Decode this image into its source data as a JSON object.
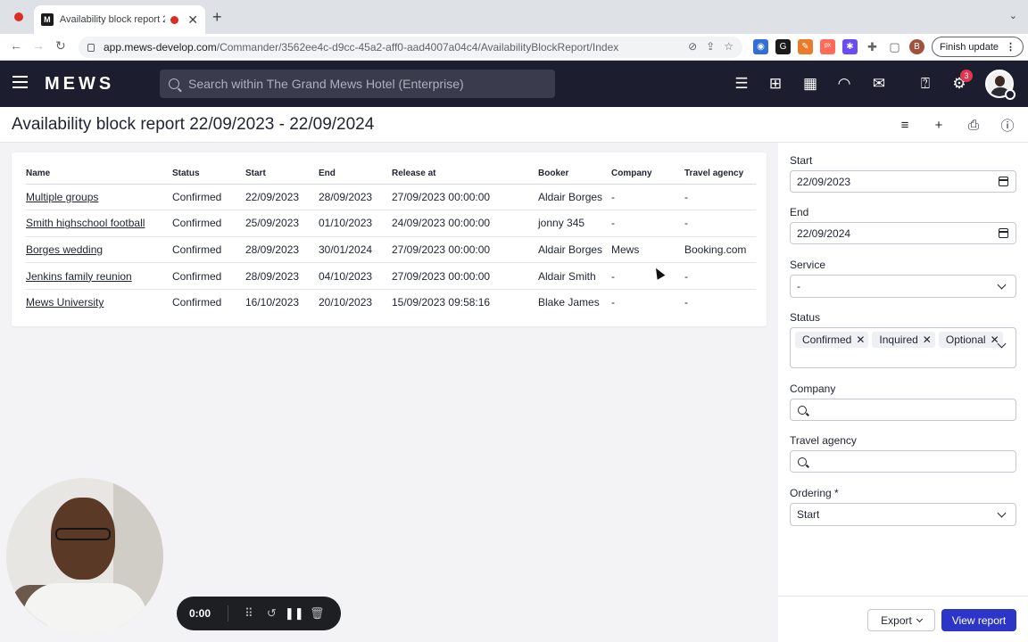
{
  "browser": {
    "tab_title": "Availability block report 2",
    "tab_close": "✕",
    "new_tab": "+",
    "url_main": "app.mews-develop.com",
    "url_path": "/Commander/3562ee4c-d9cc-45a2-aff0-aad4007a04c4/AvailabilityBlockReport/Index",
    "profile_initial": "B",
    "finish_update": "Finish update"
  },
  "header": {
    "logo": "MEWS",
    "search_placeholder": "Search within The Grand Mews Hotel (Enterprise)",
    "notification_count": "3"
  },
  "page": {
    "title": "Availability block report 22/09/2023 - 22/09/2024"
  },
  "table": {
    "columns": [
      "Name",
      "Status",
      "Start",
      "End",
      "Release at",
      "Booker",
      "Company",
      "Travel agency"
    ],
    "rows": [
      {
        "name": "Multiple groups",
        "status": "Confirmed",
        "start": "22/09/2023",
        "end": "28/09/2023",
        "release": "27/09/2023 00:00:00",
        "booker": "Aldair Borges",
        "company": "-",
        "agency": "-"
      },
      {
        "name": "Smith highschool football",
        "status": "Confirmed",
        "start": "25/09/2023",
        "end": "01/10/2023",
        "release": "24/09/2023 00:00:00",
        "booker": "jonny 345",
        "company": "-",
        "agency": "-"
      },
      {
        "name": "Borges wedding",
        "status": "Confirmed",
        "start": "28/09/2023",
        "end": "30/01/2024",
        "release": "27/09/2023 00:00:00",
        "booker": "Aldair Borges",
        "company": "Mews",
        "agency": "Booking.com"
      },
      {
        "name": "Jenkins family reunion",
        "status": "Confirmed",
        "start": "28/09/2023",
        "end": "04/10/2023",
        "release": "27/09/2023 00:00:00",
        "booker": "Aldair Smith",
        "company": "-",
        "agency": "-"
      },
      {
        "name": "Mews University",
        "status": "Confirmed",
        "start": "16/10/2023",
        "end": "20/10/2023",
        "release": "15/09/2023 09:58:16",
        "booker": "Blake James",
        "company": "-",
        "agency": "-"
      }
    ]
  },
  "filters": {
    "start_label": "Start",
    "start_value": "22/09/2023",
    "end_label": "End",
    "end_value": "22/09/2024",
    "service_label": "Service",
    "service_value": "-",
    "status_label": "Status",
    "status_chips": [
      "Confirmed",
      "Inquired",
      "Optional"
    ],
    "company_label": "Company",
    "agency_label": "Travel agency",
    "ordering_label": "Ordering *",
    "ordering_value": "Start"
  },
  "footer": {
    "export_label": "Export",
    "view_label": "View report"
  },
  "recorder": {
    "time": "0:00"
  },
  "colors": {
    "header_bg": "#1c1d2e",
    "primary_button": "#2d35c8",
    "badge": "#e0364f"
  }
}
